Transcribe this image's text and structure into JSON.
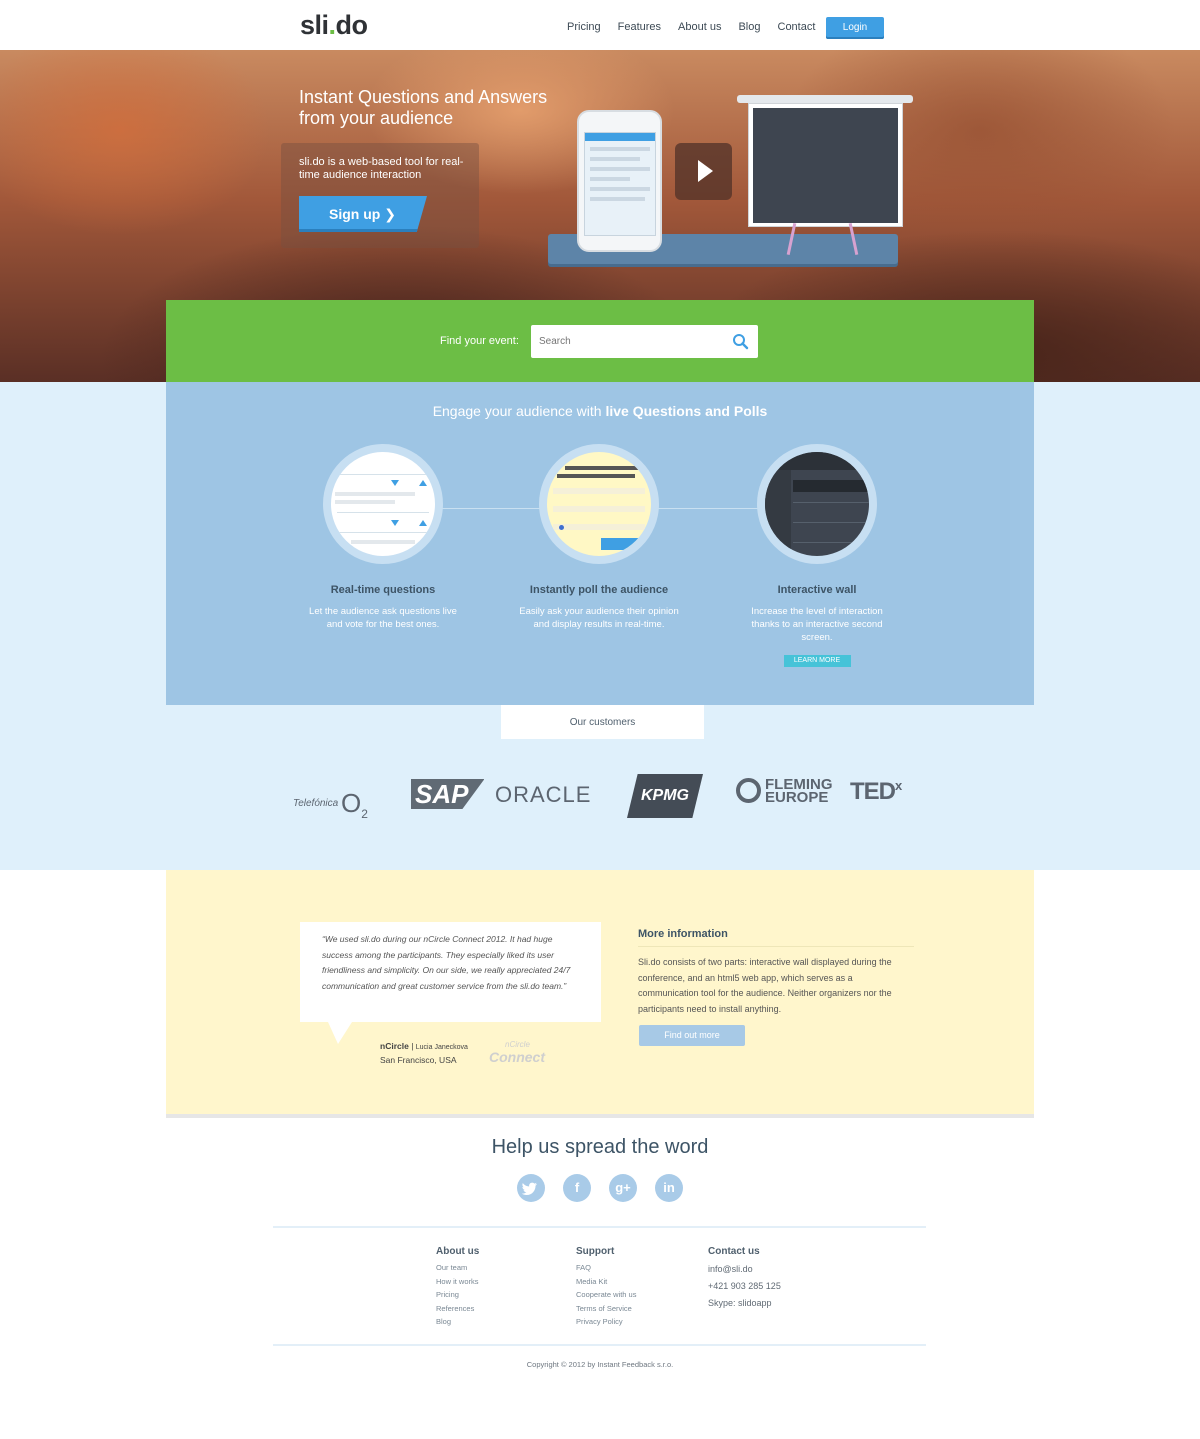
{
  "header": {
    "logo_left": "sli",
    "logo_dot": ".",
    "logo_right": "do",
    "nav": [
      "Pricing",
      "Features",
      "About us",
      "Blog",
      "Contact"
    ],
    "login_label": "Login"
  },
  "hero": {
    "title": "Instant Questions and Answers from your audience",
    "description": "sli.do is a web-based tool for real-time audience interaction",
    "signup_label": "Sign up ❯"
  },
  "search": {
    "label": "Find your event:",
    "placeholder": "Search"
  },
  "engage": {
    "title_plain": "Engage your audience with ",
    "title_bold": "live Questions and Polls",
    "features": [
      {
        "title": "Real-time questions",
        "description": "Let the audience ask questions live and vote for the best ones."
      },
      {
        "title": "Instantly poll the audience",
        "description": "Easily ask your audience their opinion and display results in real-time."
      },
      {
        "title": "Interactive wall",
        "description": "Increase the level of interaction thanks to an interactive second screen.",
        "button": "LEARN MORE"
      }
    ]
  },
  "customers": {
    "tab_label": "Our customers",
    "logos": [
      "Telefónica O2",
      "SAP",
      "ORACLE",
      "KPMG",
      "FLEMING EUROPE",
      "TEDx"
    ]
  },
  "testimonial": {
    "quote": "“We used sli.do during our nCircle Connect 2012. It had huge success among the participants. They especially liked its user friendliness and simplicity. On our side, we really appreciated 24/7 communication and great customer service from the sli.do team.”",
    "company": "nCircle",
    "person": "Lucia Janeckova",
    "location": "San Francisco, USA",
    "logo_top": "nCircle",
    "logo_bottom": "Connect"
  },
  "more_info": {
    "title": "More information",
    "description": "Sli.do consists of two parts: interactive wall displayed during the conference, and an html5 web app, which serves as a communication tool for the audience. Neither organizers nor the participants need to install anything.",
    "button": "Find out more"
  },
  "spread": {
    "title": "Help us spread the word",
    "icons": [
      "twitter-icon",
      "facebook-icon",
      "google-plus-icon",
      "linkedin-icon"
    ]
  },
  "footer": {
    "about": {
      "title": "About us",
      "links": [
        "Our team",
        "How it works",
        "Pricing",
        "References",
        "Blog"
      ]
    },
    "support": {
      "title": "Support",
      "links": [
        "FAQ",
        "Media Kit",
        "Cooperate with us",
        "Terms of Service",
        "Privacy Policy"
      ]
    },
    "contact": {
      "title": "Contact us",
      "email": "info@sli.do",
      "phone": "+421 903 285 125",
      "skype": "Skype: slidoapp"
    },
    "copyright": "Copyright © 2012 by Instant Feedback s.r.o."
  },
  "colors": {
    "accent_blue": "#3f9fe3",
    "green": "#6cbe45",
    "engage_blue": "#9ec5e4",
    "light_blue": "#dff0fb",
    "cream": "#fff6cc"
  }
}
